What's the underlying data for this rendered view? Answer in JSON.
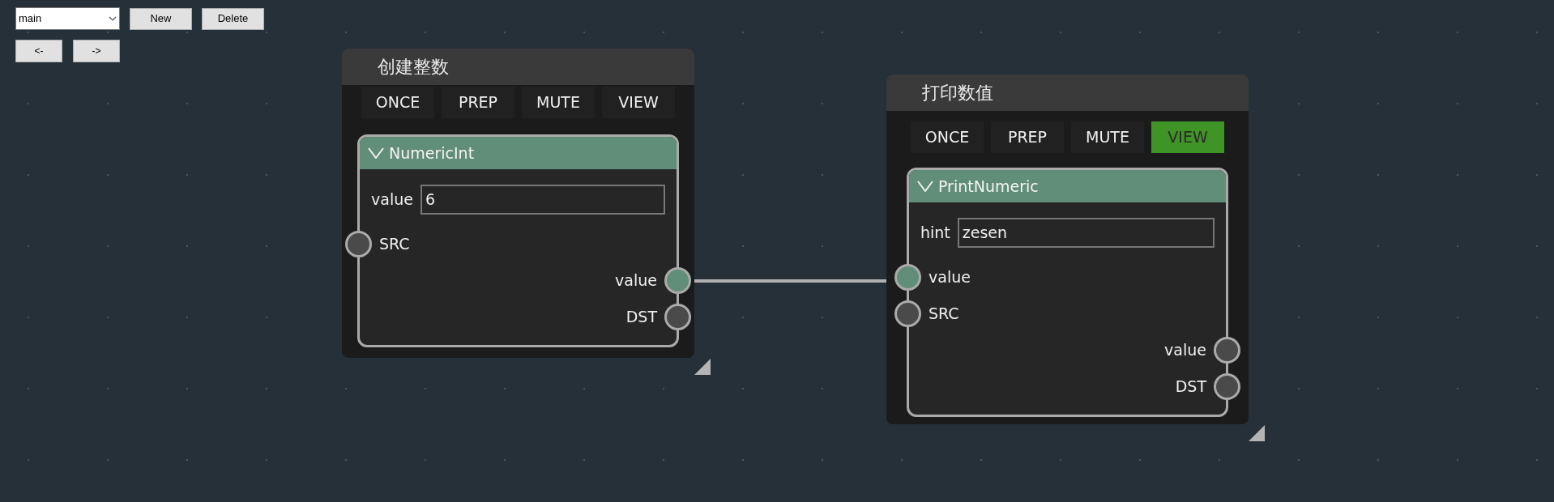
{
  "toolbar": {
    "graph_select": {
      "value": "main"
    },
    "buttons": [
      "New",
      "Delete"
    ],
    "nav_buttons": [
      "<-",
      "->"
    ]
  },
  "nodes": [
    {
      "title": "创建整数",
      "toggles": [
        {
          "label": "ONCE",
          "selected": false
        },
        {
          "label": "PREP",
          "selected": false
        },
        {
          "label": "MUTE",
          "selected": false
        },
        {
          "label": "VIEW",
          "selected": false
        }
      ],
      "card": {
        "title": "NumericInt",
        "expanded": true,
        "field": {
          "label": "value",
          "value": "6"
        },
        "ports": [
          {
            "label": "SRC",
            "kind": "in",
            "connected": false
          },
          {
            "label": "value",
            "kind": "out",
            "connected": true
          },
          {
            "label": "DST",
            "kind": "out",
            "connected": false
          }
        ]
      }
    },
    {
      "title": "打印数值",
      "toggles": [
        {
          "label": "ONCE",
          "selected": false
        },
        {
          "label": "PREP",
          "selected": false
        },
        {
          "label": "MUTE",
          "selected": false
        },
        {
          "label": "VIEW",
          "selected": true
        }
      ],
      "card": {
        "title": "PrintNumeric",
        "expanded": true,
        "field": {
          "label": "hint",
          "value": "zesen"
        },
        "ports": [
          {
            "label": "value",
            "kind": "in",
            "connected": true
          },
          {
            "label": "SRC",
            "kind": "in",
            "connected": false
          },
          {
            "label": "value",
            "kind": "out",
            "connected": false
          },
          {
            "label": "DST",
            "kind": "out",
            "connected": false
          }
        ]
      }
    }
  ]
}
